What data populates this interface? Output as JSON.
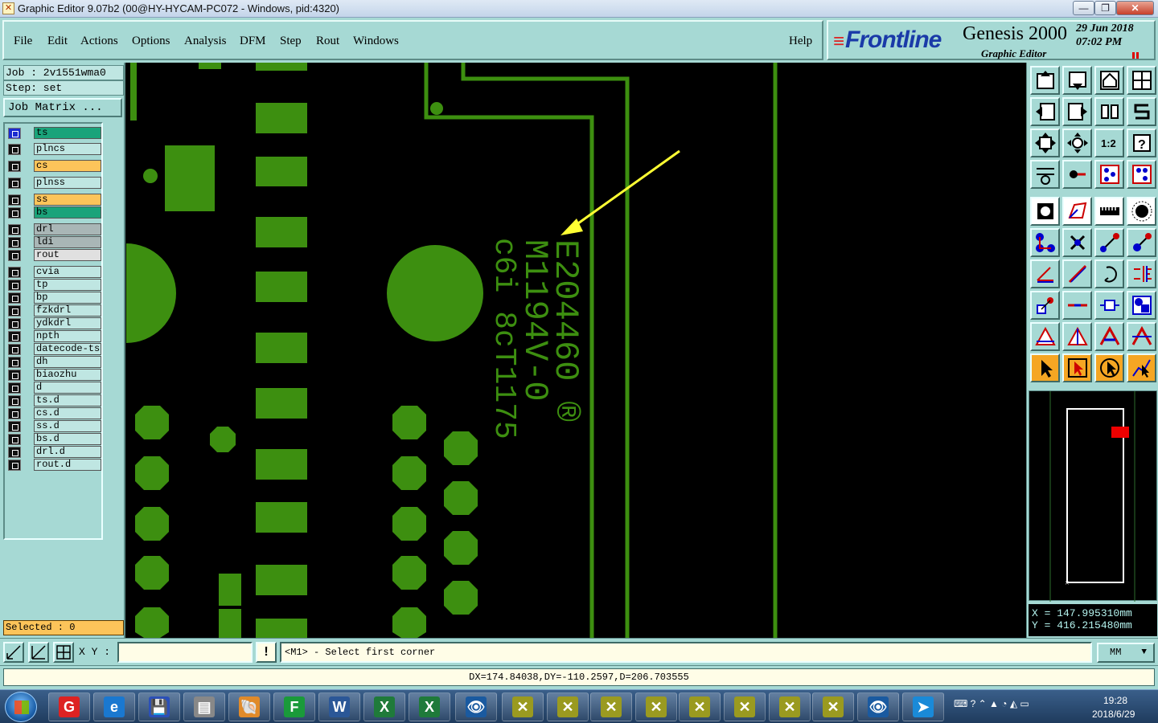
{
  "window": {
    "title": "Graphic Editor 9.07b2 (00@HY-HYCAM-PC072 - Windows, pid:4320)",
    "app_icon": "x-app-icon",
    "min_glyph": "—",
    "max_glyph": "❐",
    "close_glyph": "✕"
  },
  "menu": {
    "items": [
      "File",
      "Edit",
      "Actions",
      "Options",
      "Analysis",
      "DFM",
      "Step",
      "Rout",
      "Windows"
    ],
    "help": "Help"
  },
  "brand": {
    "logo": "Frontline",
    "product": "Genesis 2000",
    "subtitle": "Graphic Editor",
    "date": "29 Jun 2018",
    "time": "07:02 PM"
  },
  "job": {
    "job_label": "Job : 2v1551wma0",
    "step_label": "Step: set",
    "matrix_button": "Job Matrix ..."
  },
  "layers": [
    {
      "name": "ts",
      "color": "#1aa37a",
      "active": true
    },
    {
      "name": "plncs",
      "color": "#bfe6e2"
    },
    {
      "name": "cs",
      "color": "#fcc45a"
    },
    {
      "name": "plnss",
      "color": "#bfe6e2"
    },
    {
      "name": "ss",
      "color": "#fcc45a"
    },
    {
      "name": "bs",
      "color": "#1aa37a"
    },
    {
      "name": "drl",
      "color": "#a9b6b6"
    },
    {
      "name": "ldi",
      "color": "#a9b6b6"
    },
    {
      "name": "rout",
      "color": "#e0e0e0"
    },
    {
      "name": "cvia",
      "color": "#bfe6e2"
    },
    {
      "name": "tp",
      "color": "#bfe6e2"
    },
    {
      "name": "bp",
      "color": "#bfe6e2"
    },
    {
      "name": "fzkdrl",
      "color": "#bfe6e2"
    },
    {
      "name": "ydkdrl",
      "color": "#bfe6e2"
    },
    {
      "name": "npth",
      "color": "#bfe6e2"
    },
    {
      "name": "datecode-ts",
      "color": "#bfe6e2"
    },
    {
      "name": "dh",
      "color": "#bfe6e2"
    },
    {
      "name": "biaozhu",
      "color": "#bfe6e2"
    },
    {
      "name": "d",
      "color": "#bfe6e2"
    },
    {
      "name": "ts.d",
      "color": "#bfe6e2"
    },
    {
      "name": "cs.d",
      "color": "#bfe6e2"
    },
    {
      "name": "ss.d",
      "color": "#bfe6e2"
    },
    {
      "name": "bs.d",
      "color": "#bfe6e2"
    },
    {
      "name": "drl.d",
      "color": "#bfe6e2"
    },
    {
      "name": "rout.d",
      "color": "#bfe6e2"
    }
  ],
  "selected": "Selected : 0",
  "canvas": {
    "silkscreen_line1": "E204460 ®",
    "silkscreen_line2": "M1194V-0",
    "silkscreen_line3": "c6i 8cT1175",
    "feature_color": "#3d8f10",
    "arrow_color": "#ffff33"
  },
  "coords": {
    "x": "X = 147.995310mm",
    "y": "Y = 416.215480mm"
  },
  "command": {
    "xy_label": "X Y :",
    "xy_value": "",
    "warn": "!",
    "prompt": "<M1> - Select first corner",
    "units": "MM",
    "units_arrow": "▼"
  },
  "measure": "DX=174.84038,DY=-110.2597,D=206.703555",
  "taskbar": {
    "apps": [
      "G",
      "e",
      "💾",
      "▤",
      "🐚",
      "F",
      "W",
      "X",
      "X",
      "👁",
      "✕",
      "✕",
      "✕",
      "✕",
      "✕",
      "✕",
      "✕",
      "✕",
      "👁",
      "➤"
    ],
    "tray": "⌨ ? ⌃ ▲ ◔ ◭ ▭",
    "time": "19:28",
    "date": "2018/6/29"
  }
}
